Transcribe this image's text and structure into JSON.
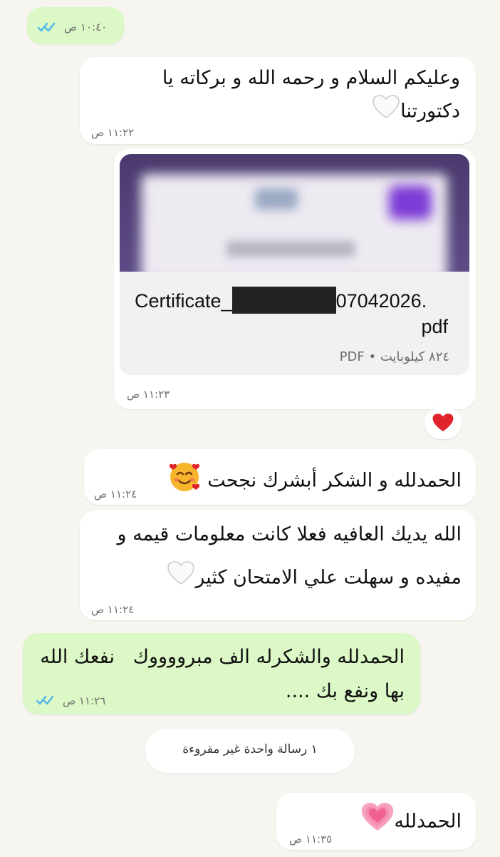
{
  "colors": {
    "background": "#f7f5f0",
    "incoming_bubble": "#ffffff",
    "outgoing_bubble": "#dcf8c6",
    "read_ticks": "#4fb6ec",
    "heart_red": "#e0242c"
  },
  "messages": [
    {
      "id": "m1",
      "direction": "outgoing",
      "time": "١٠:٤٠ ص",
      "read": true
    },
    {
      "id": "m2",
      "direction": "incoming",
      "text_line1": "وعليكم السلام و رحمه الله و بركاته يا",
      "text_line2": "دكتورتنا",
      "emoji": "white-heart-icon",
      "time": "١١:٢٢ ص"
    },
    {
      "id": "m3",
      "direction": "incoming",
      "type": "document",
      "file_name_prefix": "Certificate_",
      "file_name_suffix": "07042026.",
      "file_ext": "pdf",
      "file_size": "٨٢٤ كيلوبايت",
      "file_type": "PDF",
      "separator": "•",
      "time": "١١:٢٣ ص",
      "reaction": "red-heart-icon"
    },
    {
      "id": "m4",
      "direction": "incoming",
      "text": "الحمدلله و الشكر أبشرك نجحت",
      "emoji": "smiling-face-with-hearts-icon",
      "time": "١١:٢٤ ص"
    },
    {
      "id": "m5",
      "direction": "incoming",
      "text_line1": "الله يديك العافيه فعلا كانت معلومات قيمه و",
      "text_line2": "مفيده و سهلت علي الامتحان كثير",
      "emoji": "white-heart-icon",
      "time": "١١:٢٤ ص"
    },
    {
      "id": "m6",
      "direction": "outgoing",
      "text_line1": "الحمدلله والشكرله الف مبرووووك   نفعك الله",
      "text_line2": "بها ونفع بك ....",
      "time": "١١:٢٦ ص",
      "read": true
    },
    {
      "id": "m7",
      "direction": "incoming",
      "text": "الحمدلله",
      "emoji": "growing-heart-icon",
      "time": "١١:٣٥ ص"
    }
  ],
  "unread_banner": "١ رسالة واحدة غير مقروءة"
}
